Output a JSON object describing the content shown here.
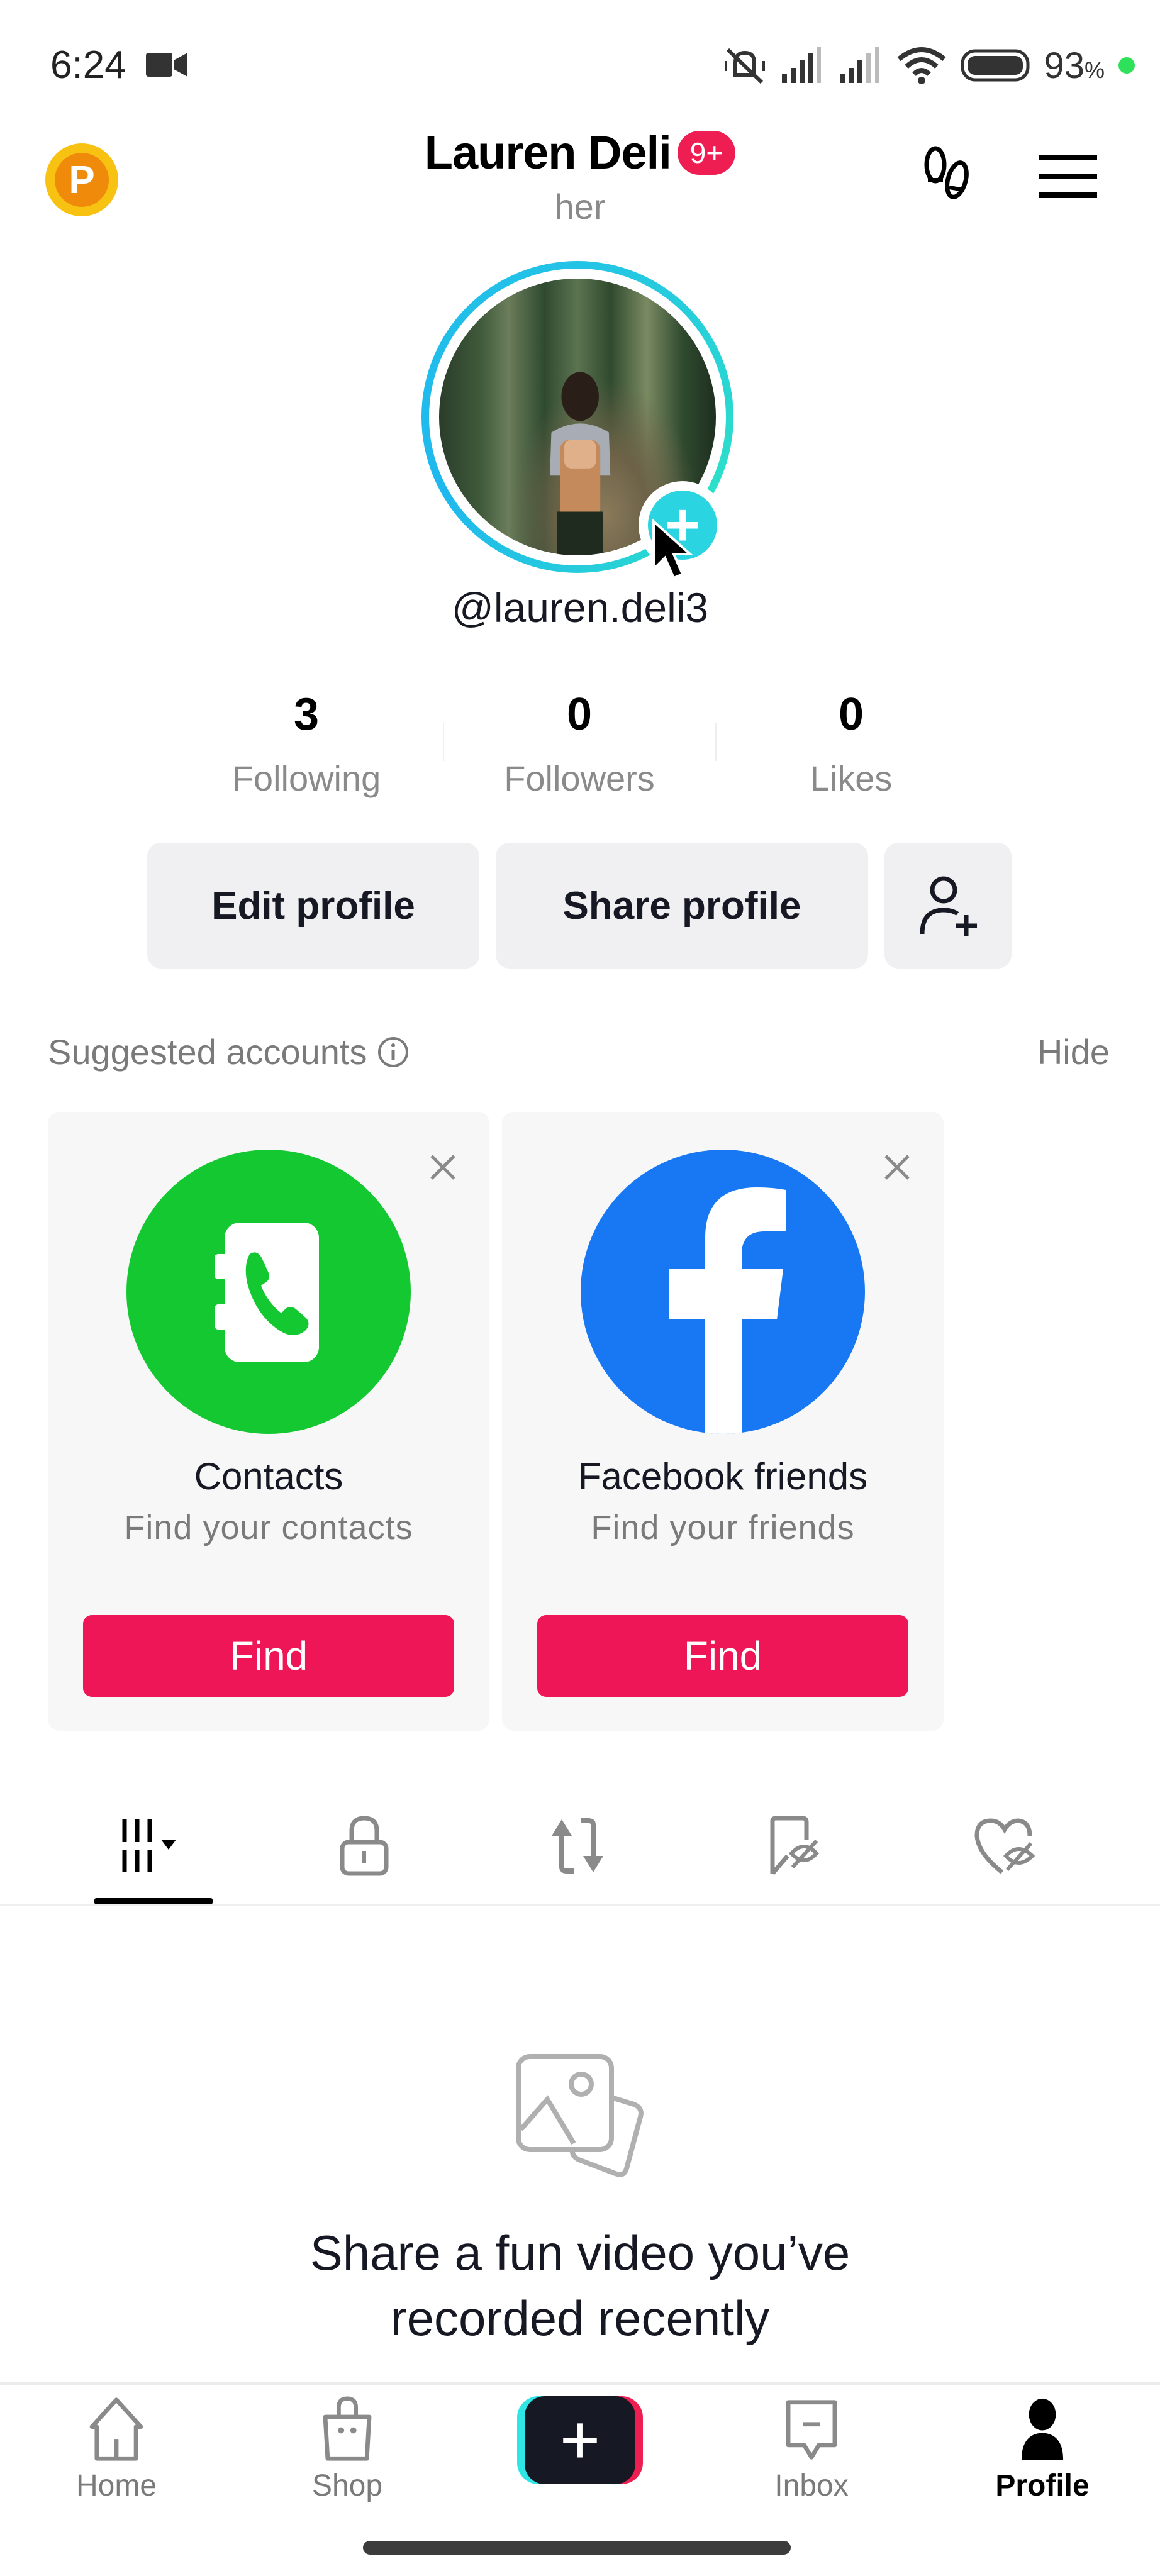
{
  "status_bar": {
    "time": "6:24",
    "battery_percent": "93",
    "battery_suffix": "%",
    "icons": [
      "video-camera-icon",
      "mute-vibrate-icon",
      "signal-icon",
      "signal-icon",
      "wifi-icon",
      "battery-icon"
    ]
  },
  "header": {
    "coin_letter": "P",
    "name": "Lauren Deli",
    "notification_badge": "9+",
    "pronoun": "her",
    "icons": [
      "footprint-icon",
      "menu-icon"
    ]
  },
  "profile": {
    "handle": "@lauren.deli3",
    "avatar_add_symbol": "+"
  },
  "stats": [
    {
      "value": "3",
      "label": "Following"
    },
    {
      "value": "0",
      "label": "Followers"
    },
    {
      "value": "0",
      "label": "Likes"
    }
  ],
  "actions": {
    "edit": "Edit profile",
    "share": "Share profile"
  },
  "suggested": {
    "title": "Suggested accounts",
    "hide": "Hide",
    "cards": [
      {
        "title": "Contacts",
        "subtitle": "Find your contacts",
        "button": "Find",
        "color": "#14c832"
      },
      {
        "title": "Facebook friends",
        "subtitle": "Find your friends",
        "button": "Find",
        "color": "#1877f2"
      }
    ]
  },
  "tabs": [
    {
      "name": "videos",
      "icon": "grid-icon",
      "active": true
    },
    {
      "name": "private",
      "icon": "lock-icon",
      "active": false
    },
    {
      "name": "reposts",
      "icon": "repost-icon",
      "active": false
    },
    {
      "name": "favorites",
      "icon": "bookmark-hidden-icon",
      "active": false
    },
    {
      "name": "liked",
      "icon": "heart-hidden-icon",
      "active": false
    }
  ],
  "empty_state": {
    "message": "Share a fun video you’ve recorded recently"
  },
  "bottom_nav": [
    {
      "label": "Home"
    },
    {
      "label": "Shop"
    },
    {
      "label": "+"
    },
    {
      "label": "Inbox"
    },
    {
      "label": "Profile",
      "active": true
    }
  ],
  "colors": {
    "accent_pink": "#ee1656",
    "accent_cyan": "#2ad4e0",
    "coin": "#f08a0a"
  }
}
